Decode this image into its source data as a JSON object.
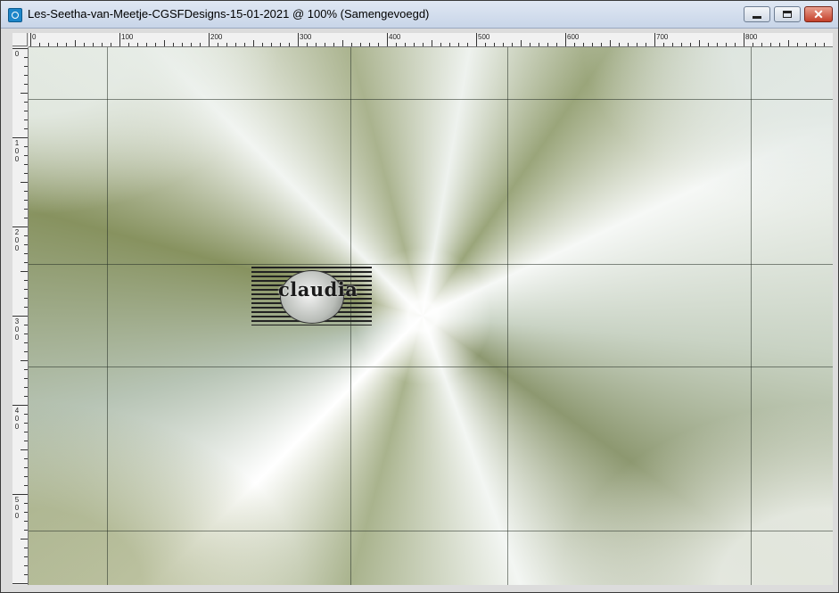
{
  "window": {
    "title": "Les-Seetha-van-Meetje-CGSFDesigns-15-01-2021 @ 100% (Samengevoegd)",
    "icon": "image-document-icon",
    "controls": {
      "minimize_icon": "minimize-icon",
      "maximize_icon": "maximize-icon",
      "close_icon": "close-icon",
      "close_glyph": "✕"
    }
  },
  "rulers": {
    "horizontal_labels": [
      "0",
      "100",
      "200",
      "300",
      "400",
      "500",
      "600",
      "700",
      "800"
    ],
    "vertical_labels": [
      "0",
      "100",
      "200",
      "300",
      "400",
      "500"
    ]
  },
  "canvas": {
    "zoom": "100%",
    "watermark_text": "claudia",
    "colors": {
      "olive": "#8d9870",
      "light": "#f3f6f3",
      "sage": "#b7c4b5"
    }
  }
}
